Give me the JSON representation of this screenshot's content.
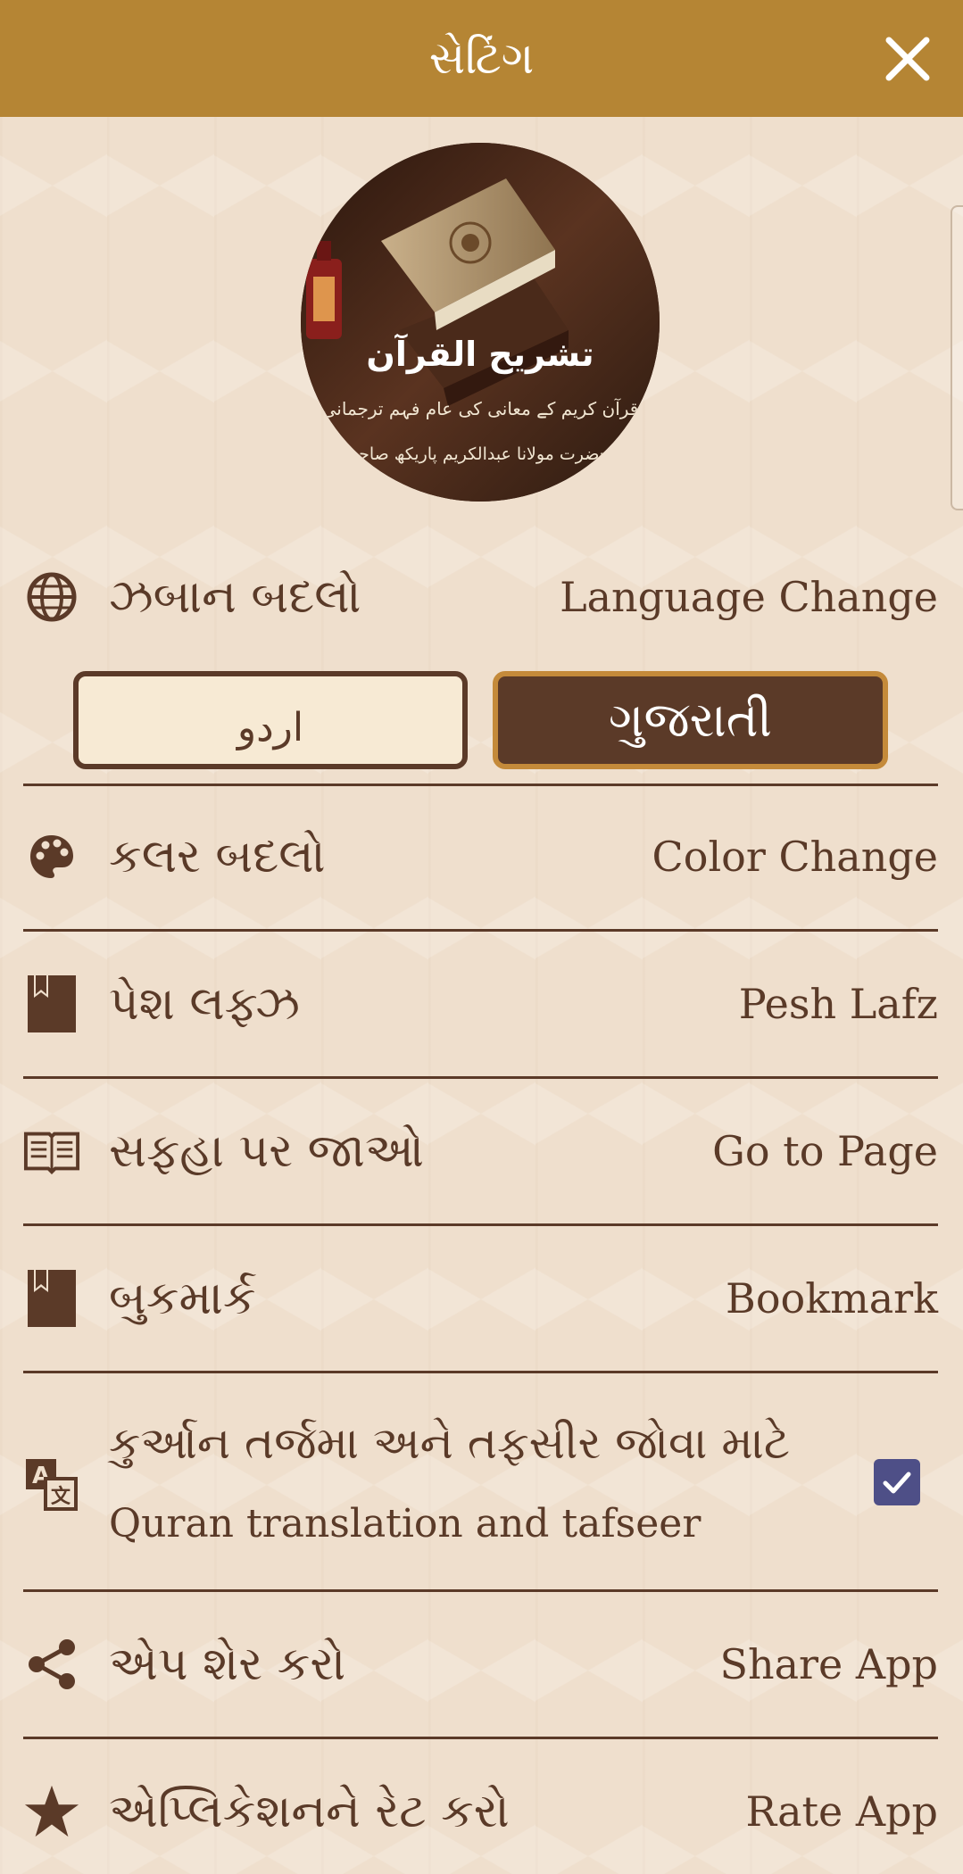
{
  "header": {
    "title": "સેટિંગ"
  },
  "logo": {
    "title": "تشریح القرآن",
    "subtitle": "قرآن کریم کے معانی کی عام فہم ترجمانی",
    "author": "از حضرت مولانا عبدالکریم پاریکھ صاحبؒ"
  },
  "language": {
    "label_gu": "ઝબાન બદલો",
    "label_en": "Language Change",
    "options": [
      "اردو",
      "ગુજરાતી"
    ],
    "selected": "ગુજરાતી"
  },
  "menu": [
    {
      "gu": "કલર બદલો",
      "en": "Color Change",
      "icon": "palette-icon"
    },
    {
      "gu": "પેશ લફ્ઝ",
      "en": "Pesh Lafz",
      "icon": "bookmark-icon"
    },
    {
      "gu": "સફહા પર જાઓ",
      "en": "Go to Page",
      "icon": "open-book-icon"
    },
    {
      "gu": "બુકમાર્ક",
      "en": "Bookmark",
      "icon": "bookmark-icon"
    }
  ],
  "translation": {
    "gu": "કુર્આન તર્જમા અને તફસીર જોવા માટે",
    "en": "Quran translation and tafseer",
    "checked": true,
    "icon": "translate-icon"
  },
  "menu_bottom": [
    {
      "gu": "એપ શેર કરો",
      "en": "Share App",
      "icon": "share-icon"
    },
    {
      "gu": "એપ્લિકેશનને રેટ કરો",
      "en": "Rate App",
      "icon": "star-icon"
    }
  ],
  "colors": {
    "header": "#b58534",
    "background": "#efdfcd",
    "text": "#5a3a28",
    "accent_border": "#c48a3a",
    "checkbox": "#4e4f87"
  }
}
